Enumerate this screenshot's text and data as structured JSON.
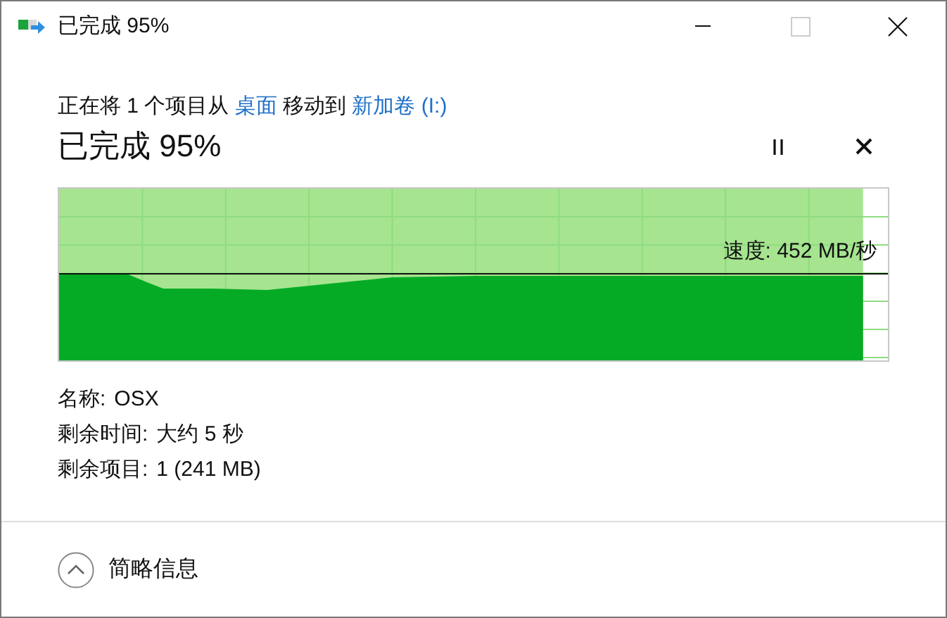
{
  "window": {
    "title": "已完成 95%"
  },
  "status_line": [
    {
      "kind": "plain",
      "text": "正在将 1 个项目从 "
    },
    {
      "kind": "link",
      "text": "桌面"
    },
    {
      "kind": "plain",
      "text": " 移动到 "
    },
    {
      "kind": "link",
      "text": "新加卷 (I:)"
    }
  ],
  "heading": "已完成 95%",
  "progress": {
    "level": 0.97,
    "speed_label": "速度: 452 MB/秒"
  },
  "details": [
    {
      "label": "名称:",
      "value": "OSX"
    },
    {
      "label": "剩余时间:",
      "value": "大约 5 秒"
    },
    {
      "label": "剩余项目:",
      "value": "1 (241 MB)"
    }
  ],
  "footer": {
    "toggle": "简略信息"
  }
}
